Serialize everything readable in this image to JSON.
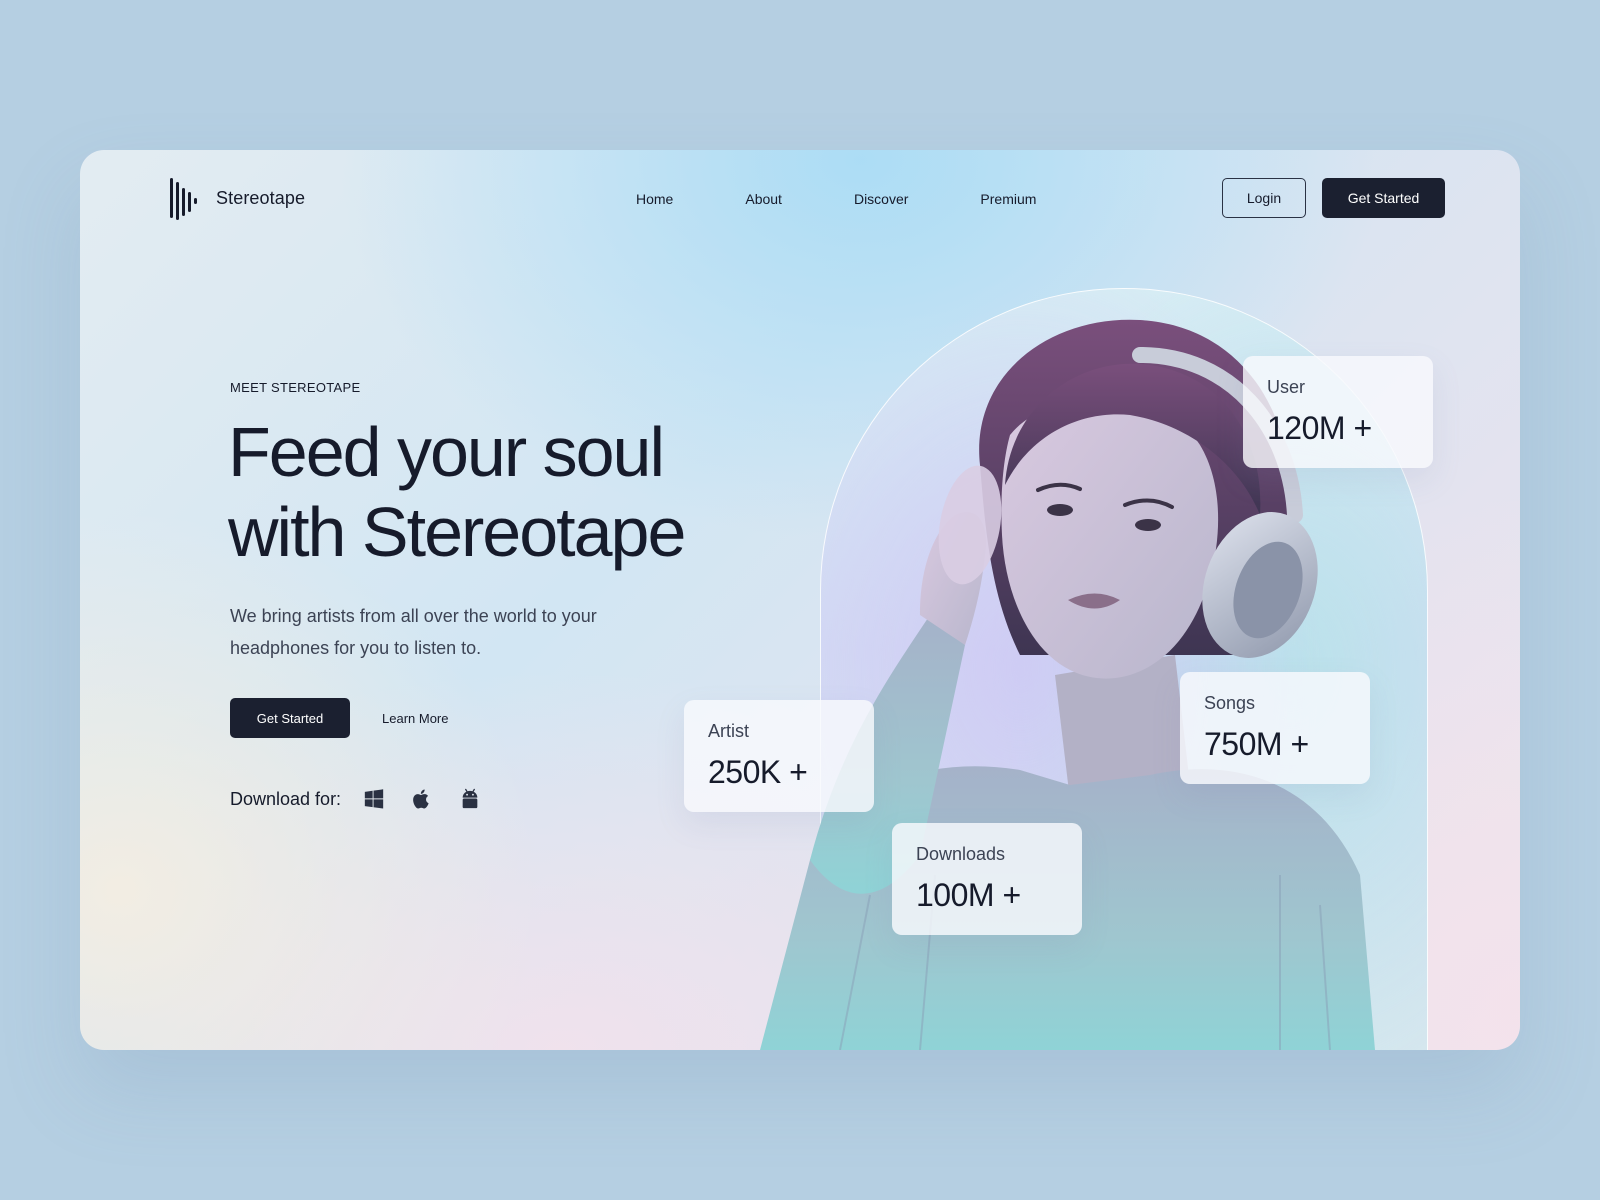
{
  "brand": {
    "name": "Stereotape"
  },
  "nav": {
    "items": [
      {
        "label": "Home"
      },
      {
        "label": "About"
      },
      {
        "label": "Discover"
      },
      {
        "label": "Premium"
      }
    ],
    "login_label": "Login",
    "get_started_label": "Get Started"
  },
  "hero": {
    "eyebrow": "MEET STEREOTAPE",
    "headline_line1": "Feed your soul",
    "headline_line2": "with Stereotape",
    "subtitle": "We bring artists from all over the world to your headphones for you to listen to.",
    "primary_cta": "Get Started",
    "secondary_cta": "Learn More",
    "download_label": "Download for:",
    "platforms": [
      "windows-icon",
      "apple-icon",
      "android-icon"
    ]
  },
  "stats": [
    {
      "label": "User",
      "value": "120M +"
    },
    {
      "label": "Artist",
      "value": "250K +"
    },
    {
      "label": "Songs",
      "value": "750M +"
    },
    {
      "label": "Downloads",
      "value": "100M +"
    }
  ],
  "colors": {
    "page_background": "#b5cfe2",
    "text_primary": "#161b2b",
    "button_dark": "#1b2030",
    "button_text": "#ffffff"
  }
}
